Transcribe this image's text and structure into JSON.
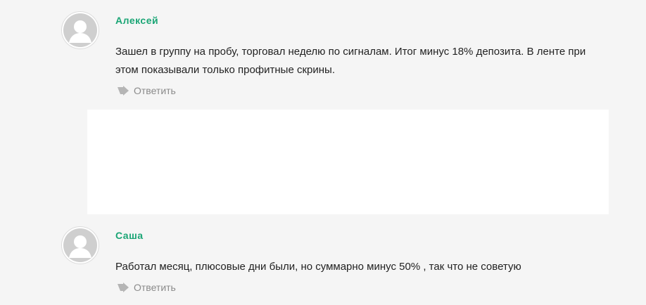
{
  "comments": [
    {
      "author": "Алексей",
      "text": "Зашел в группу на пробу, торговал неделю по сигналам. Итог минус 18% депозита. В ленте при этом показывали только профитные скрины.",
      "reply_label": "Ответить",
      "avatar_icon": "user-avatar-icon",
      "reply_icon": "reply-arrow-icon"
    },
    {
      "author": "Саша",
      "text": "Работал месяц, плюсовые дни были, но суммарно минус 50% , так что не советую",
      "reply_label": "Ответить",
      "avatar_icon": "user-avatar-icon",
      "reply_icon": "reply-arrow-icon"
    }
  ],
  "colors": {
    "background": "#f5f5f5",
    "author_name": "#1aa575",
    "text": "#222222",
    "reply": "#8a8a8a",
    "ad_block": "#ffffff"
  }
}
